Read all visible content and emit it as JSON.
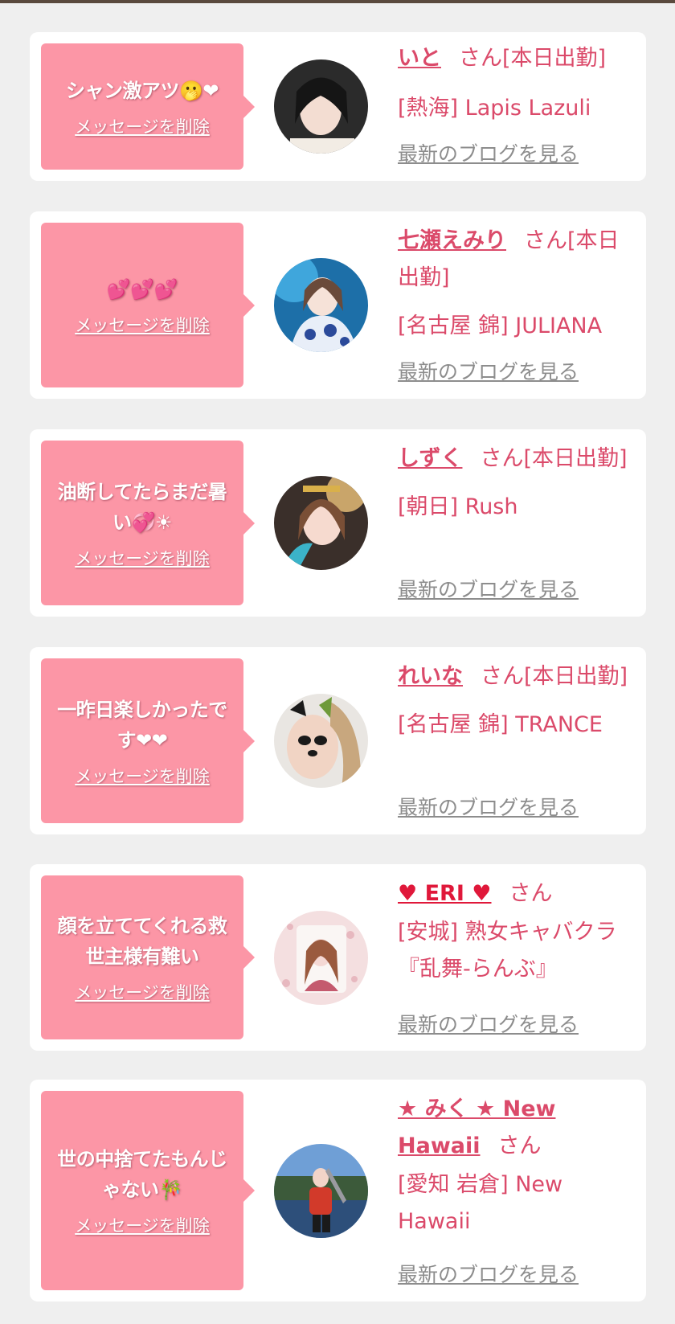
{
  "delete_label": "メッセージを削除",
  "blog_label": "最新のブログを見る",
  "cards": [
    {
      "message": "シャン激アツ🫢❤",
      "name": "いと",
      "suffix": "さん[本日出勤]",
      "location": "[熱海] Lapis Lazuli"
    },
    {
      "message": "💕💕💕",
      "name": "七瀬えみり",
      "suffix": "さん[本日出勤]",
      "location": "[名古屋 錦] JULIANA"
    },
    {
      "message": "油断してたらまだ暑い💞☀",
      "name": "しずく",
      "suffix": "さん[本日出勤]",
      "location": "[朝日] Rush"
    },
    {
      "message": "一昨日楽しかったです❤❤",
      "name": "れいな",
      "suffix": "さん[本日出勤]",
      "location": "[名古屋 錦] TRANCE"
    },
    {
      "message": "顔を立ててくれる救世主様有難い",
      "name": "♥ ERI ♥",
      "suffix": "さん",
      "location": "[安城] 熟女キャバクラ『乱舞-らんぶ』"
    },
    {
      "message": "世の中捨てたもんじゃない🎋",
      "name": "★ みく ★ New Hawaii",
      "suffix": "さん",
      "location": "[愛知 岩倉] New Hawaii"
    }
  ]
}
